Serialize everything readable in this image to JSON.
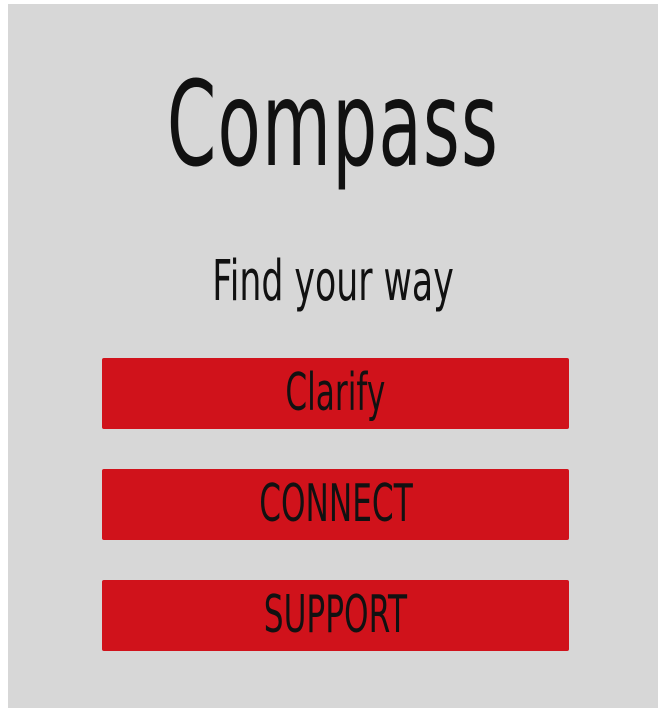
{
  "app": {
    "title": "Compass",
    "subtitle": "Find your way"
  },
  "menu": {
    "buttons": [
      {
        "label": "Clarify"
      },
      {
        "label": "CONNECT"
      },
      {
        "label": "SUPPORT"
      }
    ]
  },
  "colors": {
    "background": "#d7d7d7",
    "button": "#d0121b",
    "text": "#111111"
  }
}
